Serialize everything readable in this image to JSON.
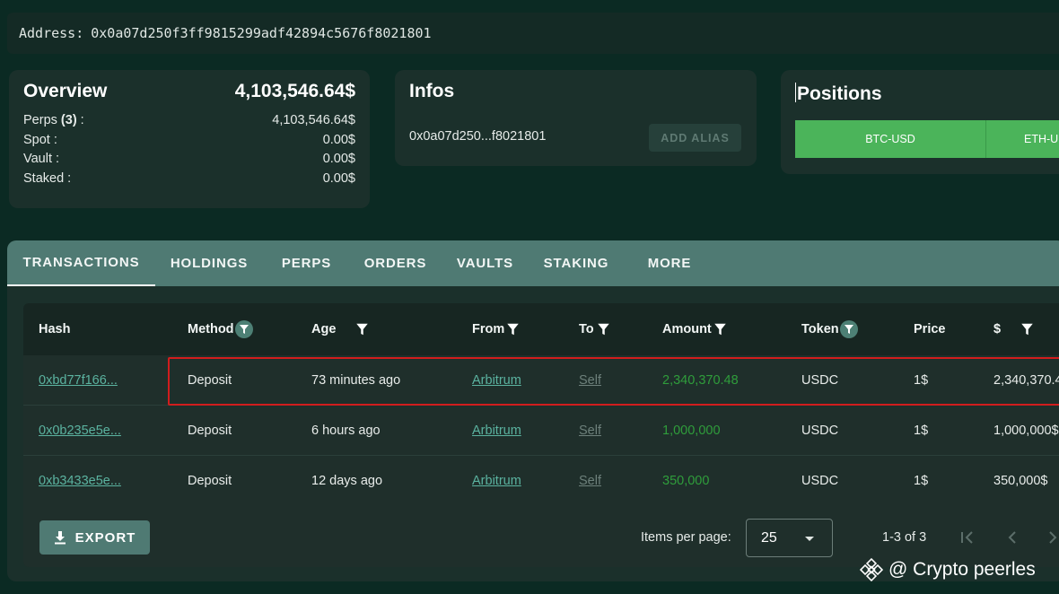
{
  "address": {
    "label": "Address:",
    "value": "0x0a07d250f3ff9815299adf42894c5676f8021801"
  },
  "overview": {
    "title": "Overview",
    "total": "4,103,546.64$",
    "rows": [
      {
        "label": "Perps",
        "count": "(3)",
        "suffix": " :",
        "value": "4,103,546.64$"
      },
      {
        "label": "Spot :",
        "value": "0.00$"
      },
      {
        "label": "Vault :",
        "value": "0.00$"
      },
      {
        "label": "Staked :",
        "value": "0.00$"
      }
    ]
  },
  "infos": {
    "title": "Infos",
    "short_address": "0x0a07d250...f8021801",
    "alias_button": "ADD ALIAS"
  },
  "positions": {
    "title": "Positions",
    "tabs": [
      "BTC-USD",
      "ETH-U"
    ]
  },
  "tabs": [
    "TRANSACTIONS",
    "HOLDINGS",
    "PERPS",
    "ORDERS",
    "VAULTS",
    "STAKING",
    "MORE"
  ],
  "table": {
    "headers": [
      "Hash",
      "Method",
      "Age",
      "From",
      "To",
      "Amount",
      "Token",
      "Price",
      "$"
    ],
    "rows": [
      {
        "hash": "0xbd77f166...",
        "method": "Deposit",
        "age": "73 minutes ago",
        "from": "Arbitrum",
        "to": "Self",
        "amount": "2,340,370.48",
        "token": "USDC",
        "price": "1$",
        "usd": "2,340,370.4"
      },
      {
        "hash": "0x0b235e5e...",
        "method": "Deposit",
        "age": "6 hours ago",
        "from": "Arbitrum",
        "to": "Self",
        "amount": "1,000,000",
        "token": "USDC",
        "price": "1$",
        "usd": "1,000,000$"
      },
      {
        "hash": "0xb3433e5e...",
        "method": "Deposit",
        "age": "12 days ago",
        "from": "Arbitrum",
        "to": "Self",
        "amount": "350,000",
        "token": "USDC",
        "price": "1$",
        "usd": "350,000$"
      }
    ]
  },
  "footer": {
    "export_label": "EXPORT",
    "items_per_page_label": "Items per page:",
    "items_per_page_value": "25",
    "range": "1-3 of 3"
  },
  "watermark": "@ Crypto peerles",
  "colors": {
    "background": "#0b2a23",
    "card": "#1b302b",
    "tabbar": "#4f7a73",
    "positive": "#2f9d3b",
    "link": "#5bb3a0",
    "highlight": "#d11d1d",
    "position_tab": "#4bb45a"
  }
}
